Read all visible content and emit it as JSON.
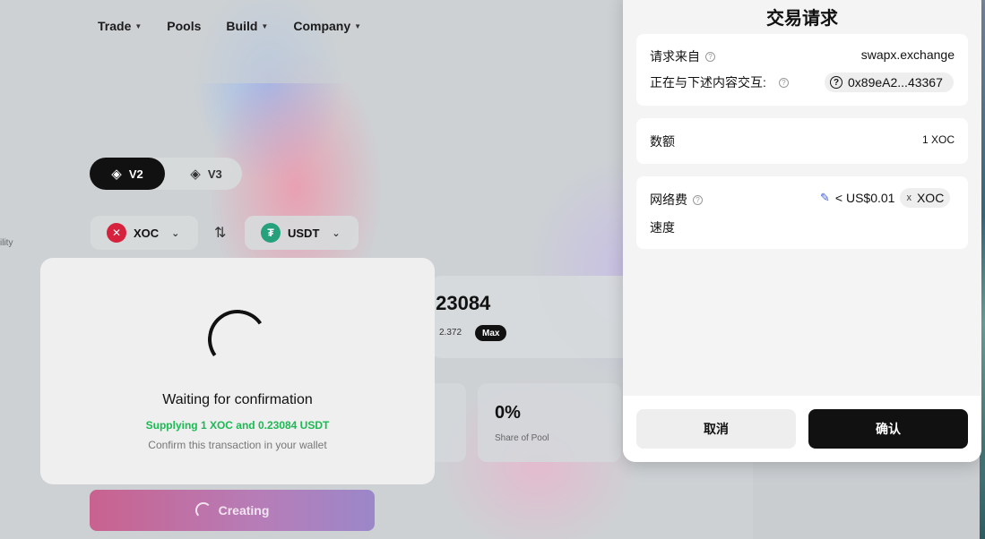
{
  "dapp": {
    "nav": [
      {
        "label": "Trade",
        "has_dropdown": true
      },
      {
        "label": "Pools",
        "has_dropdown": false
      },
      {
        "label": "Build",
        "has_dropdown": true
      },
      {
        "label": "Company",
        "has_dropdown": true
      }
    ],
    "side_label": "ility",
    "version_toggle": {
      "v2": "V2",
      "v3": "V3",
      "selected": "V2"
    },
    "token_a": {
      "symbol": "XOC",
      "icon": "xoc-token-icon",
      "color": "#d6223c"
    },
    "token_b": {
      "symbol": "USDT",
      "icon": "usdt-token-icon",
      "color": "#26a17b"
    },
    "amount": ".23084",
    "balance": "2.372",
    "max_label": "Max",
    "share_value": "0%",
    "share_label": "Share of Pool",
    "create_button": "Creating"
  },
  "waiting_modal": {
    "title": "Waiting for confirmation",
    "supply_text": "Supplying 1 XOC and 0.23084 USDT",
    "hint": "Confirm this transaction in your wallet",
    "accent_color": "#1db954"
  },
  "wallet": {
    "title": "交易请求",
    "request_from_label": "请求来自",
    "request_from_value": "swapx.exchange",
    "interacting_label": "正在与下述内容交互:",
    "interacting_address": "0x89eA2...43367",
    "amount_label": "数额",
    "amount_value": "1 XOC",
    "fee_label": "网络费",
    "fee_value": "< US$0.01",
    "fee_token": "XOC",
    "fee_token_x": "x",
    "speed_label": "速度",
    "cancel_button": "取消",
    "confirm_button": "确认"
  }
}
